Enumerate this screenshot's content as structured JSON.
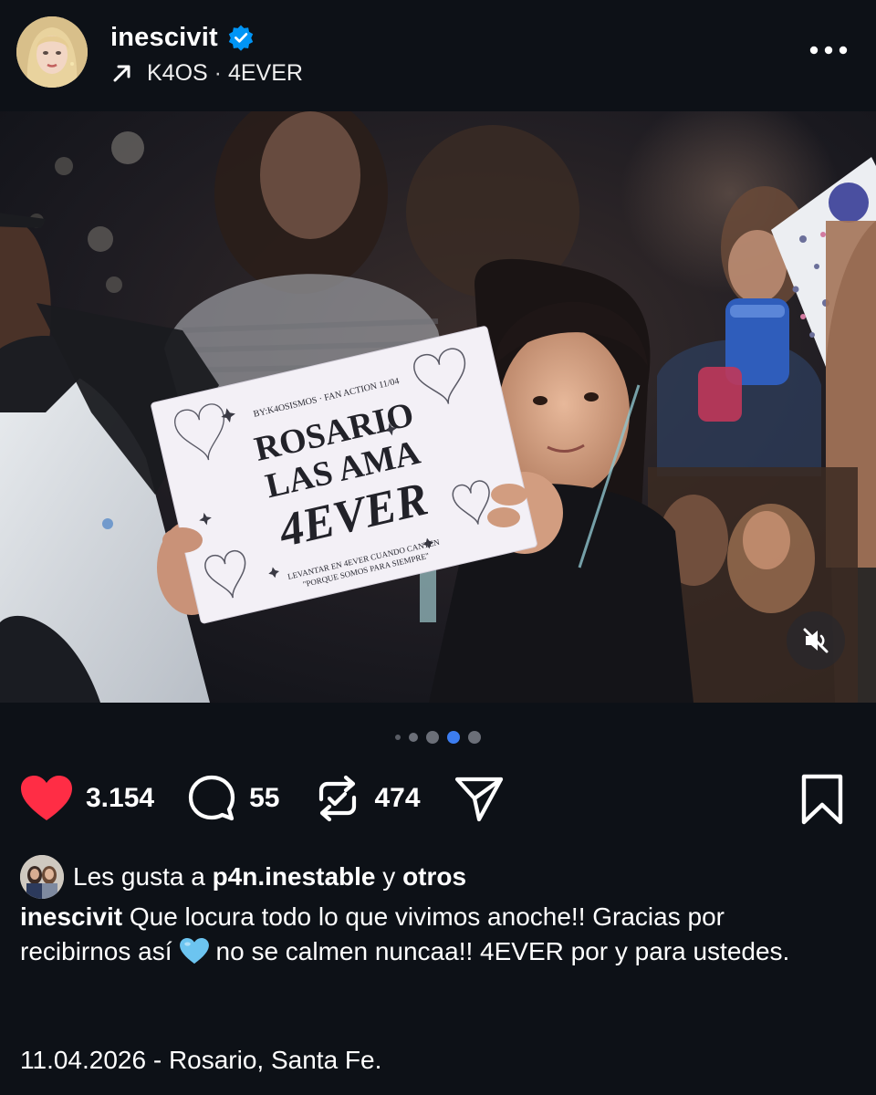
{
  "header": {
    "username": "inescivit",
    "audio": {
      "artist": "K4OS",
      "separator": "·",
      "track": "4EVER"
    },
    "icons": [
      "verified-badge-icon",
      "arrow-up-right-icon",
      "more-options-icon"
    ]
  },
  "media": {
    "sign": {
      "top_line": "BY:K4OSISMOS · FAN ACTION 11/04",
      "line1": "ROSARIO",
      "line2": "LAS AMA",
      "line3": "4EVER",
      "footer1": "LEVANTAR EN 4EVER CUANDO CANTEN",
      "footer2": "\"PORQUE SOMOS PARA SIEMPRE\""
    },
    "mute_icon": "speaker-muted-icon"
  },
  "carousel": {
    "total": 5,
    "active_index": 3
  },
  "actions": {
    "likes": "3.154",
    "comments": "55",
    "reposts": "474",
    "icons": [
      "heart-filled-icon",
      "comment-icon",
      "repost-icon",
      "share-icon",
      "bookmark-icon"
    ],
    "heart_color": "#ff2d45"
  },
  "likes_line": {
    "prefix": "Les gusta a",
    "user": "p4n.inestable",
    "connector": "y",
    "others": "otros"
  },
  "caption": {
    "username": "inescivit",
    "text_before_emoji": "Que locura todo lo que vivimos anoche!! Gracias por recibirnos así",
    "emoji": "light-blue-heart",
    "text_after_emoji": "no se calmen nuncaa!! 4EVER por y para ustedes."
  },
  "location_date": "11.04.2026 - Rosario, Santa Fe.",
  "colors": {
    "background": "#0d1117",
    "accent_blue": "#3c7df0",
    "verified_blue": "#0095f6",
    "emoji_heart": "#6cc4f0"
  }
}
